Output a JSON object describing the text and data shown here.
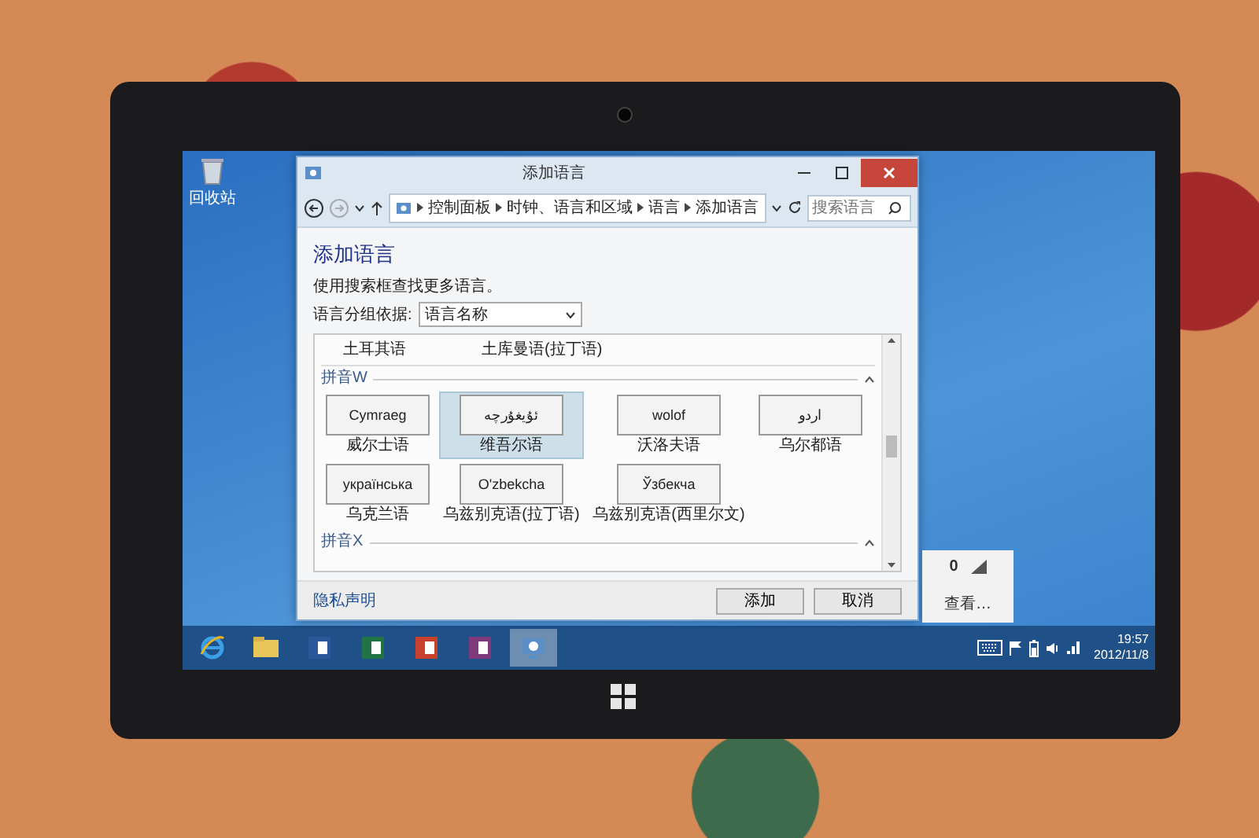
{
  "desktop": {
    "icons": [
      {
        "label": "回收站"
      }
    ]
  },
  "window": {
    "title": "添加语言",
    "breadcrumb": [
      "控制面板",
      "时钟、语言和区域",
      "语言",
      "添加语言"
    ],
    "search": {
      "placeholder": "搜索语言"
    },
    "heading": "添加语言",
    "description": "使用搜索框查找更多语言。",
    "group_by": {
      "label": "语言分组依据:",
      "value": "语言名称"
    },
    "list": {
      "partial_row": [
        "土耳其语",
        "土库曼语(拉丁语)"
      ],
      "groups": [
        {
          "header": "拼音W",
          "languages": [
            {
              "native": "Cymraeg",
              "name": "威尔士语",
              "selected": false
            },
            {
              "native": "ئۇيغۇرچە",
              "name": "维吾尔语",
              "selected": true
            },
            {
              "native": "wolof",
              "name": "沃洛夫语",
              "selected": false
            },
            {
              "native": "اردو",
              "name": "乌尔都语",
              "selected": false
            },
            {
              "native": "українська",
              "name": "乌克兰语",
              "selected": false
            },
            {
              "native": "O'zbekcha",
              "name": "乌兹别克语(拉丁语)",
              "selected": false
            },
            {
              "native": "Ўзбекча",
              "name": "乌兹别克语(西里尔文)",
              "selected": false
            }
          ]
        },
        {
          "header": "拼音X"
        }
      ]
    },
    "privacy_link": "隐私声明",
    "buttons": [
      "添加",
      "取消"
    ]
  },
  "flyout": {
    "value": "0",
    "link": "查看…"
  },
  "taskbar": {
    "apps": [
      {
        "kind": "ie",
        "selected": false
      },
      {
        "kind": "explorer",
        "selected": false
      },
      {
        "kind": "word",
        "selected": false
      },
      {
        "kind": "excel",
        "selected": false
      },
      {
        "kind": "powerpoint",
        "selected": false
      },
      {
        "kind": "onenote",
        "selected": false
      },
      {
        "kind": "control-panel",
        "selected": true
      }
    ],
    "clock": {
      "time": "19:57",
      "date": "2012/11/8"
    }
  }
}
